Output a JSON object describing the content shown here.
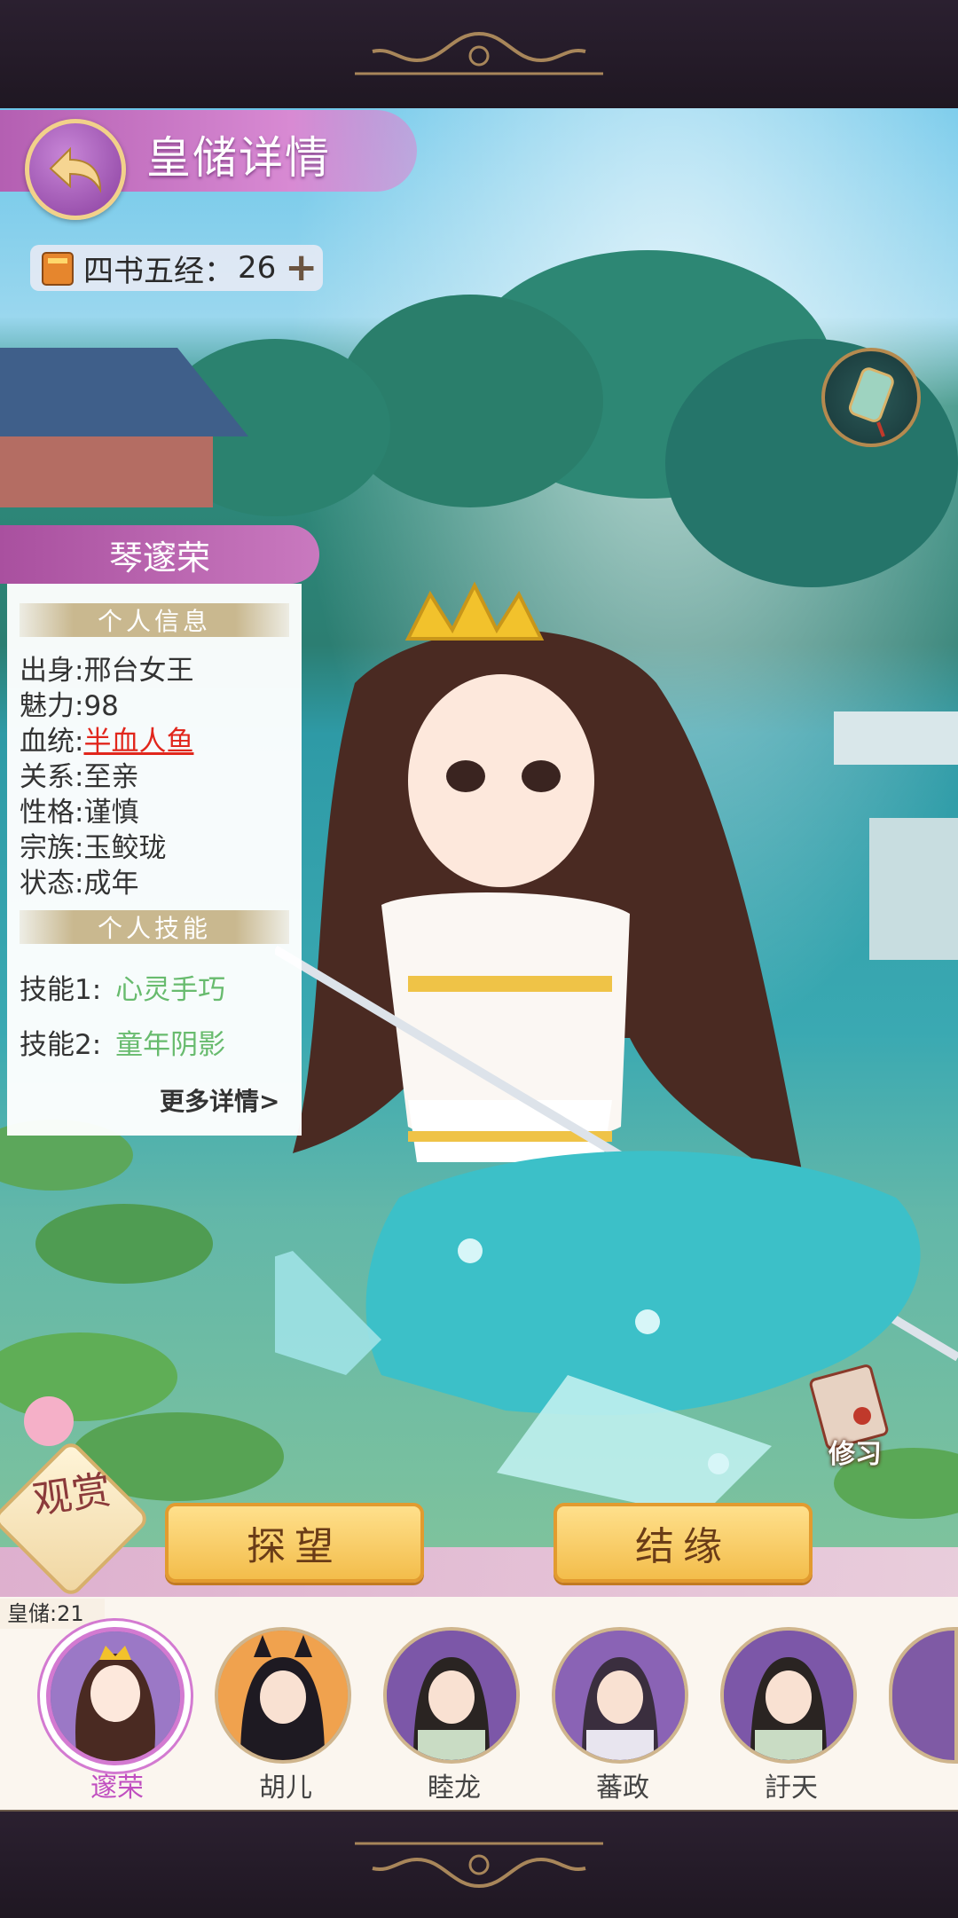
{
  "header": {
    "title": "皇储详情"
  },
  "resource": {
    "label": "四书五经：",
    "value": "26",
    "plus": "+"
  },
  "heir": {
    "name": "琴邃荣",
    "section_info": "个人信息",
    "origin": "出身:邢台女王",
    "charm": "魅力:98",
    "bloodline_label": "血统:",
    "bloodline_value": "半血人鱼",
    "relation": "关系:至亲",
    "personality": "性格:谨慎",
    "clan": "宗族:玉鲛珑",
    "status": "状态:成年",
    "section_skills": "个人技能",
    "skills": [
      {
        "label": "技能1:",
        "name": "心灵手巧"
      },
      {
        "label": "技能2:",
        "name": "童年阴影"
      }
    ],
    "more_details": "更多详情>"
  },
  "side_actions": {
    "study_label": "修习"
  },
  "view_button": {
    "label": "观赏"
  },
  "actions": {
    "visit": "探望",
    "marriage": "结缘"
  },
  "roster": {
    "count_label": "皇储:21",
    "heirs": [
      {
        "name": "邃荣",
        "selected": true
      },
      {
        "name": "胡儿",
        "selected": false
      },
      {
        "name": "睦龙",
        "selected": false
      },
      {
        "name": "蕃政",
        "selected": false
      },
      {
        "name": "訏天",
        "selected": false
      }
    ]
  },
  "colors": {
    "accent_purple": "#b45fb2",
    "skill_green": "#68bb6e",
    "link_red": "#e1261c",
    "button_gold": "#f3bd4b"
  }
}
